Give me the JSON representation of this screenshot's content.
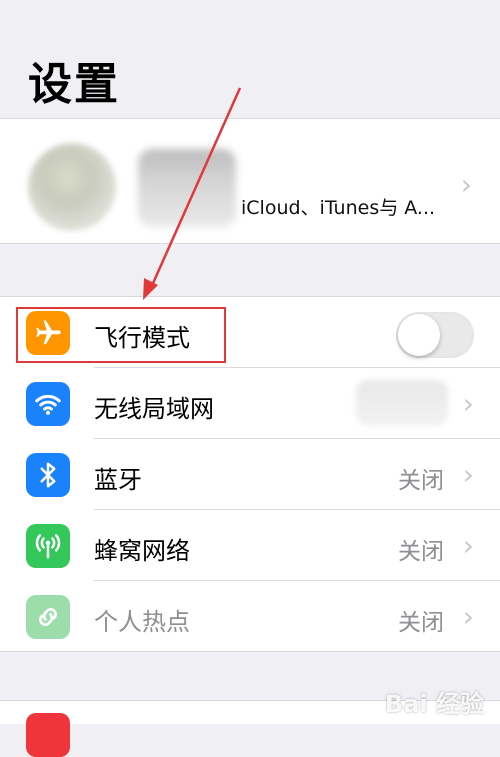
{
  "header": {
    "title": "设置"
  },
  "profile": {
    "subtitle": "iCloud、iTunes与 A..."
  },
  "settings": {
    "items": [
      {
        "label": "飞行模式",
        "icon": "airplane-icon",
        "color": "#ff9500",
        "toggle": "off"
      },
      {
        "label": "无线局域网",
        "icon": "wifi-icon",
        "color": "#1a82fb"
      },
      {
        "label": "蓝牙",
        "icon": "bluetooth-icon",
        "color": "#1a82fb",
        "value": "关闭"
      },
      {
        "label": "蜂窝网络",
        "icon": "antenna-icon",
        "color": "#34c759",
        "value": "关闭"
      },
      {
        "label": "个人热点",
        "icon": "hotspot-icon",
        "color": "#9ddcab",
        "value": "关闭"
      }
    ]
  },
  "annotation": {
    "color": "#e0393b"
  },
  "watermark": "Bai 经验"
}
